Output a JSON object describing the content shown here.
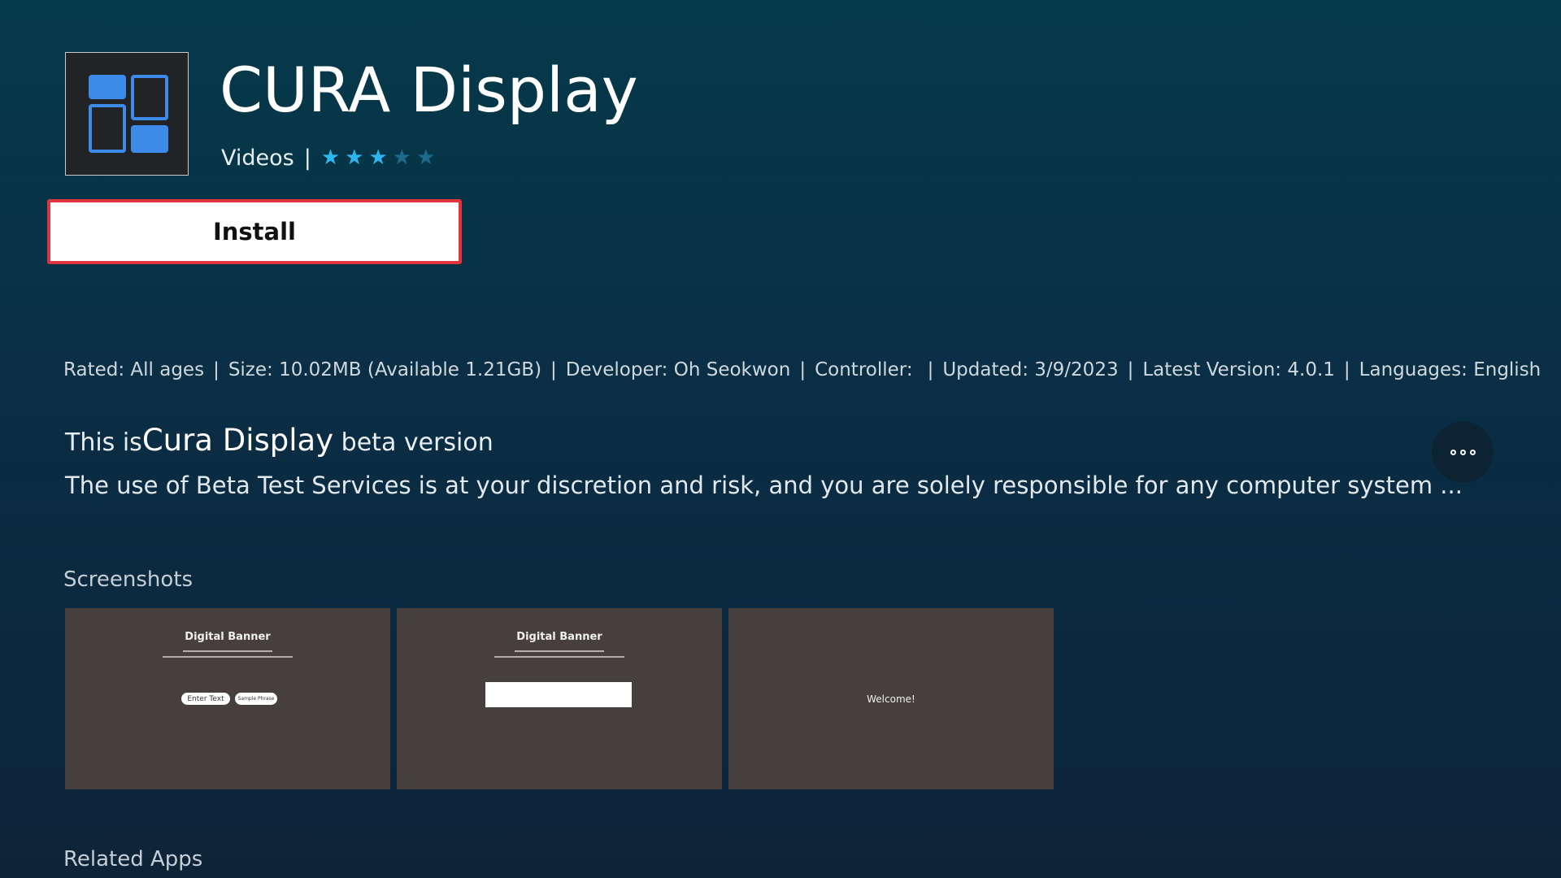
{
  "app": {
    "title": "CURA Display",
    "category": "Videos",
    "rating": 3,
    "rating_max": 5,
    "icon": "grid-tiles-icon"
  },
  "actions": {
    "install_label": "Install",
    "more_icon": "more-options-icon"
  },
  "info": {
    "rated": "Rated: All ages",
    "size": "Size: 10.02MB (Available 1.21GB)",
    "developer": "Developer: Oh Seokwon",
    "controller": "Controller:",
    "updated": "Updated: 3/9/2023",
    "version": "Latest Version: 4.0.1",
    "languages": "Languages: English"
  },
  "description": {
    "prefix": "This is",
    "name": "Cura Display",
    "suffix": " beta version",
    "body": "The use of Beta Test Services is at your discretion and risk, and you are solely responsible for any computer system ..."
  },
  "screenshots": {
    "heading": "Screenshots",
    "items": [
      {
        "title": "Digital Banner",
        "button1": "Enter Text",
        "button2": "Sample Phrase"
      },
      {
        "title": "Digital Banner"
      },
      {
        "caption": "Welcome!"
      }
    ]
  },
  "related": {
    "heading": "Related Apps"
  },
  "colors": {
    "star_filled": "#2fb6f0",
    "star_empty": "#1c6b8c",
    "focus_border": "#e0353f",
    "icon_blue": "#3d8be8"
  }
}
